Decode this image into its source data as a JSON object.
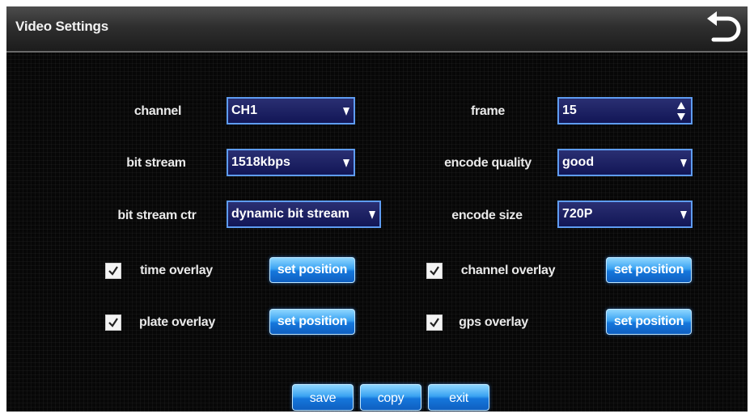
{
  "header": {
    "title": "Video Settings",
    "back_icon": "undo-arrow-icon"
  },
  "form": {
    "channel": {
      "label": "channel",
      "value": "CH1"
    },
    "frame": {
      "label": "frame",
      "value": "15"
    },
    "bitstream": {
      "label": "bit stream",
      "value": "1518kbps"
    },
    "quality": {
      "label": "encode quality",
      "value": "good"
    },
    "bsctr": {
      "label": "bit stream ctr",
      "value": "dynamic bit stream"
    },
    "size": {
      "label": "encode size",
      "value": "720P"
    }
  },
  "overlays": {
    "time": {
      "label": "time overlay",
      "checked": true,
      "button": "set position"
    },
    "channel": {
      "label": "channel overlay",
      "checked": true,
      "button": "set position"
    },
    "plate": {
      "label": "plate overlay",
      "checked": true,
      "button": "set position"
    },
    "gps": {
      "label": "gps overlay",
      "checked": true,
      "button": "set position"
    }
  },
  "actions": {
    "save": "save",
    "copy": "copy",
    "exit": "exit"
  },
  "colors": {
    "select_border": "#5e9cf2",
    "select_fill": "#1a1f63",
    "button_fill": "#2a8fe8",
    "background": "#070707"
  }
}
